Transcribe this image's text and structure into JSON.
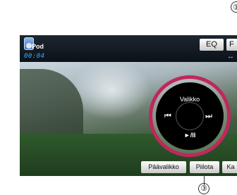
{
  "callouts": {
    "top": "①",
    "bottom": "③"
  },
  "topbar": {
    "source_label": "Pod",
    "time": "00:04",
    "eq_label": "EQ",
    "f_label": "F",
    "arrows": "↔"
  },
  "controller": {
    "menu_label": "Valikko",
    "prev": "⏮",
    "next": "⏭",
    "playpause": "►/II"
  },
  "bottom_buttons": [
    "Päävalikko",
    "Piilota",
    "Ka"
  ],
  "colors": {
    "highlight_ring": "#c0275c",
    "time_text": "#39a7ff"
  }
}
